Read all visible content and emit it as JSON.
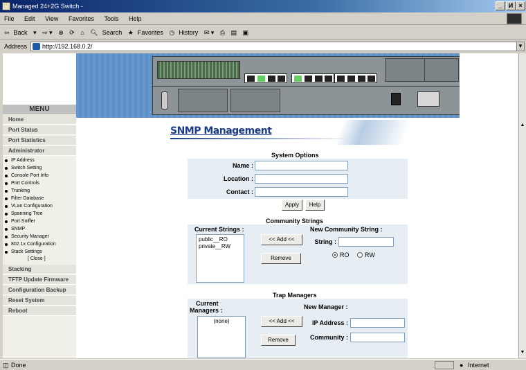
{
  "window": {
    "title": "Managed 24+2G Switch -",
    "controls": [
      "_",
      "И",
      "×"
    ]
  },
  "menubar": {
    "items": [
      "File",
      "Edit",
      "View",
      "Favorites",
      "Tools",
      "Help"
    ]
  },
  "toolbar": {
    "back": "Back",
    "search": "Search",
    "favorites": "Favorites",
    "history": "History"
  },
  "addressbar": {
    "label": "Address",
    "url": "http://192.168.0.2/"
  },
  "sidebar": {
    "heading": "MENU",
    "main_items": [
      "Home",
      "Port Status",
      "Port Statistics",
      "Administrator"
    ],
    "sub_items": [
      "IP Address",
      "Switch Setting",
      "Console Port Info",
      "Port Controls",
      "Trunking",
      "Filter Database",
      "VLan Configuration",
      "Spanning Tree",
      "Port Sniffer",
      "SNMP",
      "Security Manager",
      "802.1x Configuration",
      "Stack Settings"
    ],
    "close_label": "[ Close ]",
    "bottom_items": [
      "Stacking",
      "TFTP Update Firmware",
      "Configuration Backup",
      "Reset System",
      "Reboot"
    ]
  },
  "page": {
    "title": "SNMP Management"
  },
  "system_options": {
    "heading": "System Options",
    "name_label": "Name :",
    "location_label": "Location :",
    "contact_label": "Contact :",
    "name_value": "",
    "location_value": "",
    "contact_value": "",
    "apply": "Apply",
    "help": "Help"
  },
  "community": {
    "heading": "Community Strings",
    "current_label": "Current Strings :",
    "new_label": "New Community String :",
    "string_label": "String :",
    "string_value": "",
    "strings": [
      "public__RO",
      "private__RW"
    ],
    "add": "<< Add <<",
    "remove": "Remove",
    "ro": "RO",
    "rw": "RW",
    "selected_access": "RO"
  },
  "trap": {
    "heading": "Trap Managers",
    "current_label_1": "Current",
    "current_label_2": "Managers :",
    "new_label": "New Manager :",
    "managers": [
      "(none)"
    ],
    "add": "<< Add <<",
    "remove": "Remove",
    "ip_label": "IP Address :",
    "community_label": "Community :",
    "ip_value": "",
    "community_value": ""
  },
  "statusbar": {
    "status": "Done",
    "zone": "Internet"
  },
  "colors": {
    "title_blue": "#1a3a8a",
    "panel_bg": "#e6eef4",
    "banner_blue": "#5a8fc8"
  }
}
